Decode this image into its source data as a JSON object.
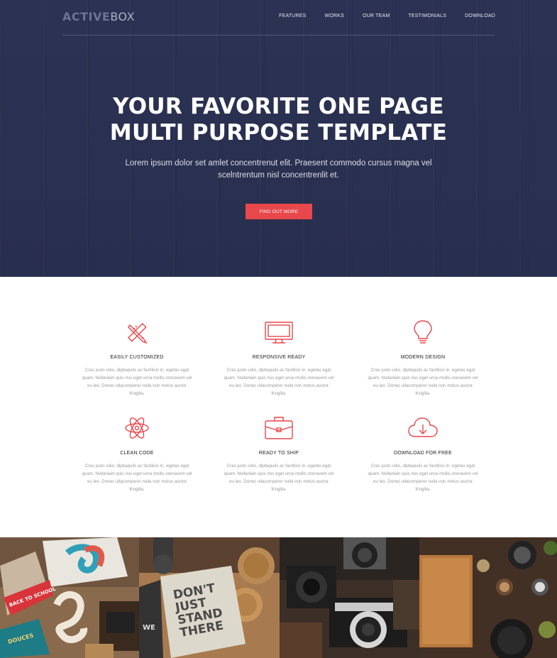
{
  "brand": {
    "part1": "ACTIVE",
    "part2": "BOX"
  },
  "nav": [
    "FEATURES",
    "WORKS",
    "OUR TEAM",
    "TESTIMONIALS",
    "DOWNLOAD"
  ],
  "hero": {
    "title_line1": "YOUR FAVORITE ONE PAGE",
    "title_line2": "MULTI PURPOSE TEMPLATE",
    "subtitle": "Lorem ipsum dolor set amlet concentrenut elit. Praesent commodo cursus magna vel scelntrentum nisl concentrenlit et.",
    "cta_label": "FIND OUT MORE"
  },
  "features": [
    {
      "title": "EASILY CUSTOMIZED",
      "icon": "pencil-ruler-icon",
      "body": "Cras justo odio, dipbapulis ac factilisic in, egetas egat quam. Nullaniain quis rius eget urna mollis orenavem vel eu leo. Donec ullacomperer nulla non metus auctor fringilla."
    },
    {
      "title": "RESPONSIVE READY",
      "icon": "monitor-icon",
      "body": "Cras justo odio, dipbapulis ac factilisic in, egetas egat quam. Nullaniain quis rius eget urna mollis orenavem vel eu leo. Donec ullacomperer nulla non metus auctor fringilla."
    },
    {
      "title": "MODERN DESIGN",
      "icon": "lightbulb-icon",
      "body": "Cras justo odio, dipbapulis ac factilisic in, egetas egat quam. Nullaniain quis rius eget urna mollis orenavem vel eu leo. Donec ullacomperer nulla non metus auctor fringilla."
    },
    {
      "title": "CLEAN CODE",
      "icon": "atom-icon",
      "body": "Cras justo odio, dipbapulis ac factilisic in, egetas egat quam. Nullaniain quis rius eget urna mollis orenavem vel eu leo. Donec ullacomperer nulla non metus auctor fringilla."
    },
    {
      "title": "READY TO SHIP",
      "icon": "briefcase-icon",
      "body": "Cras justo odio, dipbapulis ac factilisic in, egetas egat quam. Nullaniain quis rius eget urna mollis orenavem vel eu leo. Donec ullacomperer nulla non metus auctor fringilla."
    },
    {
      "title": "DOWNLOAD FOR FREE",
      "icon": "cloud-download-icon",
      "body": "Cras justo odio, dipbapulis ac factilisic in, egetas egat quam. Nullaniain quis rius eget urna mollis orenavem vel eu leo. Donec ullacomperer nulla non metus auctor fringilla."
    }
  ],
  "gallery": {
    "tile1": {
      "pennant": "BACK TO SCHOOL",
      "tag": "DOUCES"
    },
    "tile2": {
      "notebook_line1": "DON'T",
      "notebook_line2": "JUST",
      "notebook_line3": "STAND",
      "notebook_line4": "THERE",
      "side_text": "WE"
    }
  },
  "colors": {
    "accent": "#e8474b",
    "hero_bg": "#2b3152",
    "nav_text": "#e6e8f0"
  }
}
